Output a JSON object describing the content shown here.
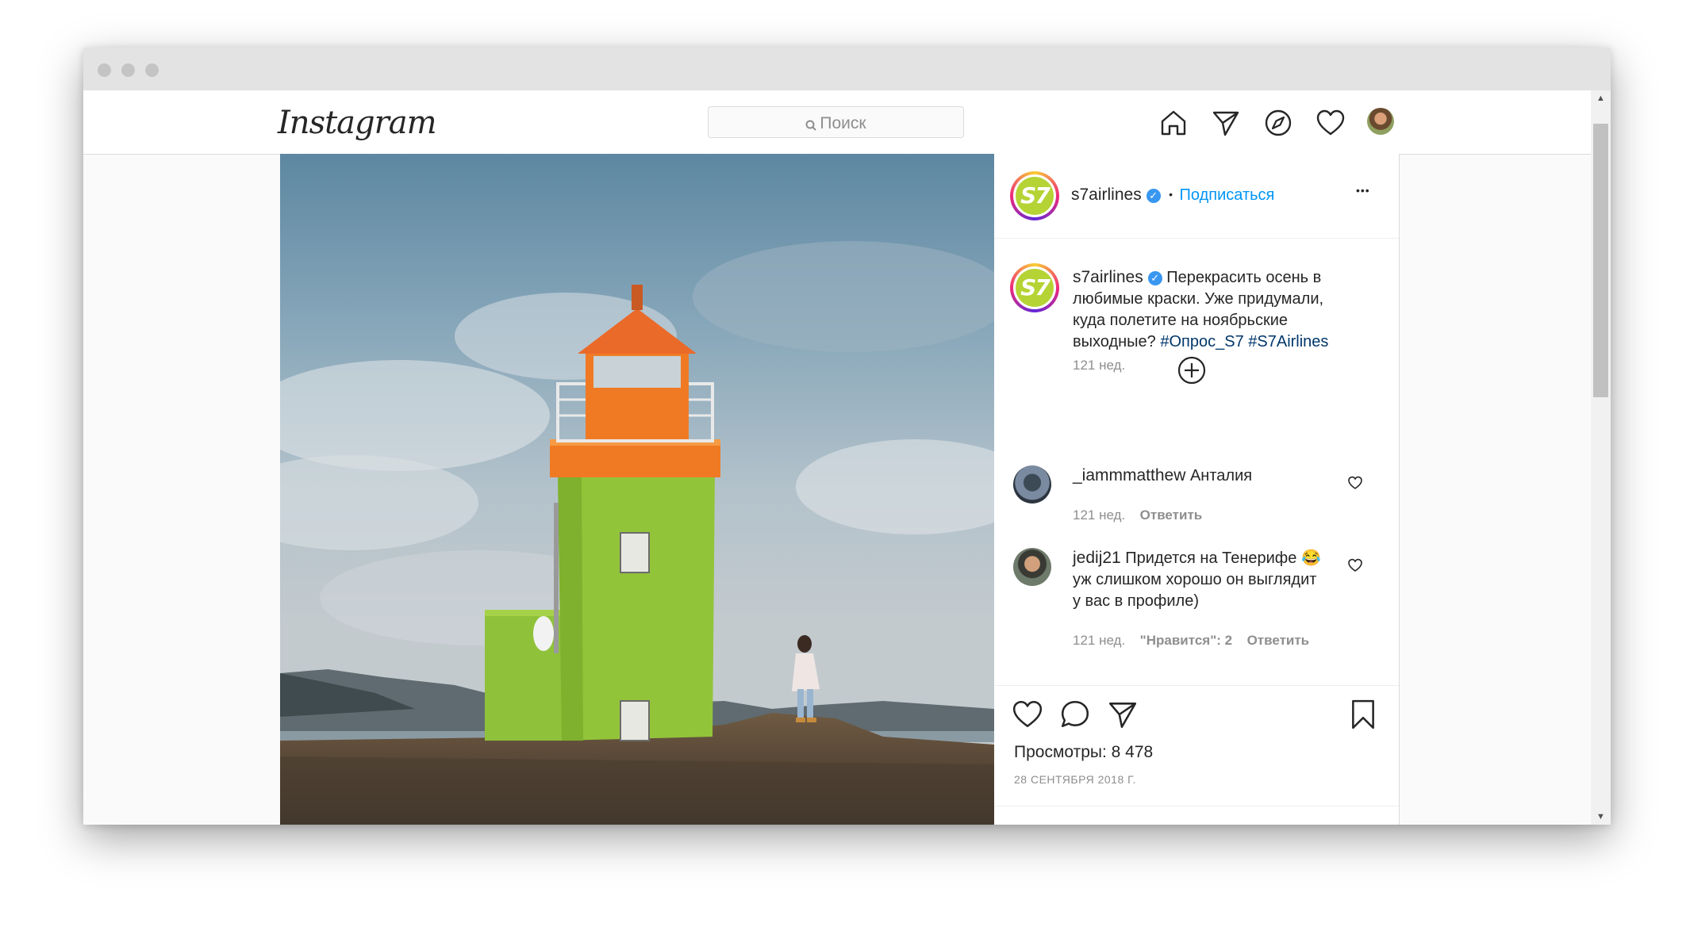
{
  "nav": {
    "logo": "Instagram",
    "search_placeholder": "Поиск"
  },
  "post": {
    "account": "s7airlines",
    "avatar_text": "S7",
    "follow_label": "Подписаться",
    "separator": "•",
    "more_label": "•••",
    "caption": {
      "text": "Перекрасить осень в любимые краски. Уже придумали, куда полетите на ноябрьские выходные?",
      "hashtag1": "#Опрос_S7",
      "hashtag2": "#S7Airlines",
      "time": "121 нед."
    },
    "comments": [
      {
        "user": "_iammmatthew",
        "text": "Анталия",
        "time": "121 нед.",
        "reply": "Ответить"
      },
      {
        "user": "jedij21",
        "text": "Придется на Тенерифе 😂 уж слишком хорошо он выглядит у вас в профиле)",
        "time": "121 нед.",
        "likes": "\"Нравится\": 2",
        "reply": "Ответить"
      }
    ],
    "views": "Просмотры: 8 478",
    "date": "28 СЕНТЯБРЯ 2018 Г."
  },
  "colors": {
    "link": "#0095f6",
    "hashtag": "#00376b",
    "s7_green": "#b5d334",
    "verified": "#3897f0"
  },
  "icons": [
    "home-icon",
    "direct-icon",
    "explore-icon",
    "activity-heart-icon",
    "like-icon",
    "comment-icon",
    "share-icon",
    "save-icon",
    "add-comment-icon",
    "verified-icon"
  ]
}
